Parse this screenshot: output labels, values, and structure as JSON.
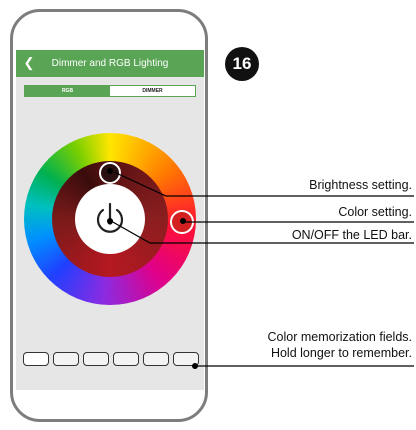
{
  "app": {
    "title": "Dimmer and RGB Lighting",
    "back_icon": "chevron-left-icon"
  },
  "tabs": [
    {
      "label": "RGB",
      "active": true
    },
    {
      "label": "DIMMER",
      "active": false
    }
  ],
  "step_number": "16",
  "callouts": {
    "brightness": "Brightness setting.",
    "color": "Color setting.",
    "onoff": "ON/OFF the LED bar.",
    "memory_line1": "Color memorization fields.",
    "memory_line2": "Hold longer to remember."
  },
  "colors": {
    "accent": "#5aa555",
    "selected_color": "#d42020",
    "brightness_knob": "#2a1010"
  }
}
